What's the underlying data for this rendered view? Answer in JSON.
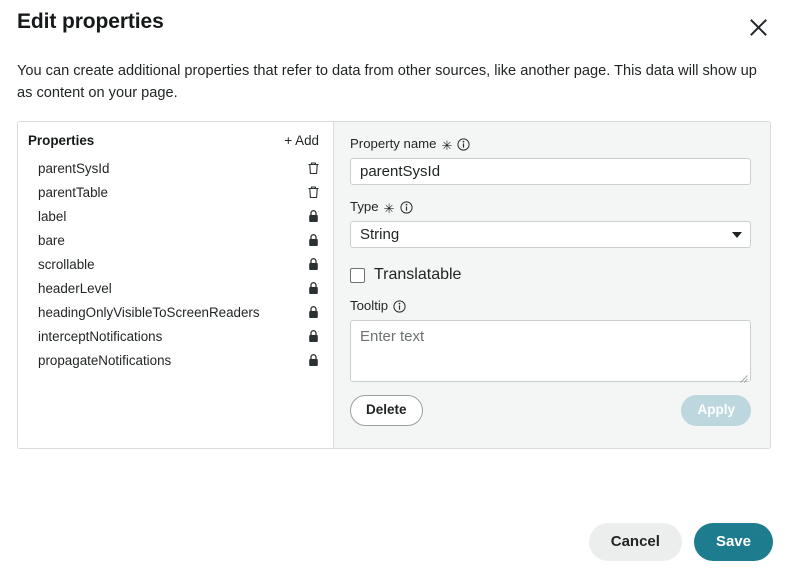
{
  "dialog": {
    "title": "Edit properties",
    "close_icon": "close-icon",
    "intro": "You can create additional properties that refer to data from other sources, like another page. This data will show up as content on your page."
  },
  "properties_pane": {
    "heading": "Properties",
    "add_label": "+ Add",
    "items": [
      {
        "name": "parentSysId",
        "action_icon": "trash-icon"
      },
      {
        "name": "parentTable",
        "action_icon": "trash-icon"
      },
      {
        "name": "label",
        "action_icon": "lock-icon"
      },
      {
        "name": "bare",
        "action_icon": "lock-icon"
      },
      {
        "name": "scrollable",
        "action_icon": "lock-icon"
      },
      {
        "name": "headerLevel",
        "action_icon": "lock-icon"
      },
      {
        "name": "headingOnlyVisibleToScreenReaders",
        "action_icon": "lock-icon"
      },
      {
        "name": "interceptNotifications",
        "action_icon": "lock-icon"
      },
      {
        "name": "propagateNotifications",
        "action_icon": "lock-icon"
      }
    ]
  },
  "detail": {
    "property_name": {
      "label": "Property name",
      "required_marker": "✳",
      "info_icon": "info-icon",
      "value": "parentSysId"
    },
    "type": {
      "label": "Type",
      "required_marker": "✳",
      "info_icon": "info-icon",
      "value": "String",
      "options": [
        "String"
      ]
    },
    "translatable": {
      "label": "Translatable",
      "checked": false
    },
    "tooltip": {
      "label": "Tooltip",
      "info_icon": "info-icon",
      "value": "",
      "placeholder": "Enter text"
    },
    "delete_label": "Delete",
    "apply_label": "Apply"
  },
  "footer": {
    "cancel_label": "Cancel",
    "save_label": "Save"
  },
  "colors": {
    "accent": "#1d7c8e",
    "apply_disabled": "#bcd8de",
    "cancel_bg": "#eceeee",
    "panel_bg": "#f4f6f6",
    "border": "#d8dcdd"
  }
}
